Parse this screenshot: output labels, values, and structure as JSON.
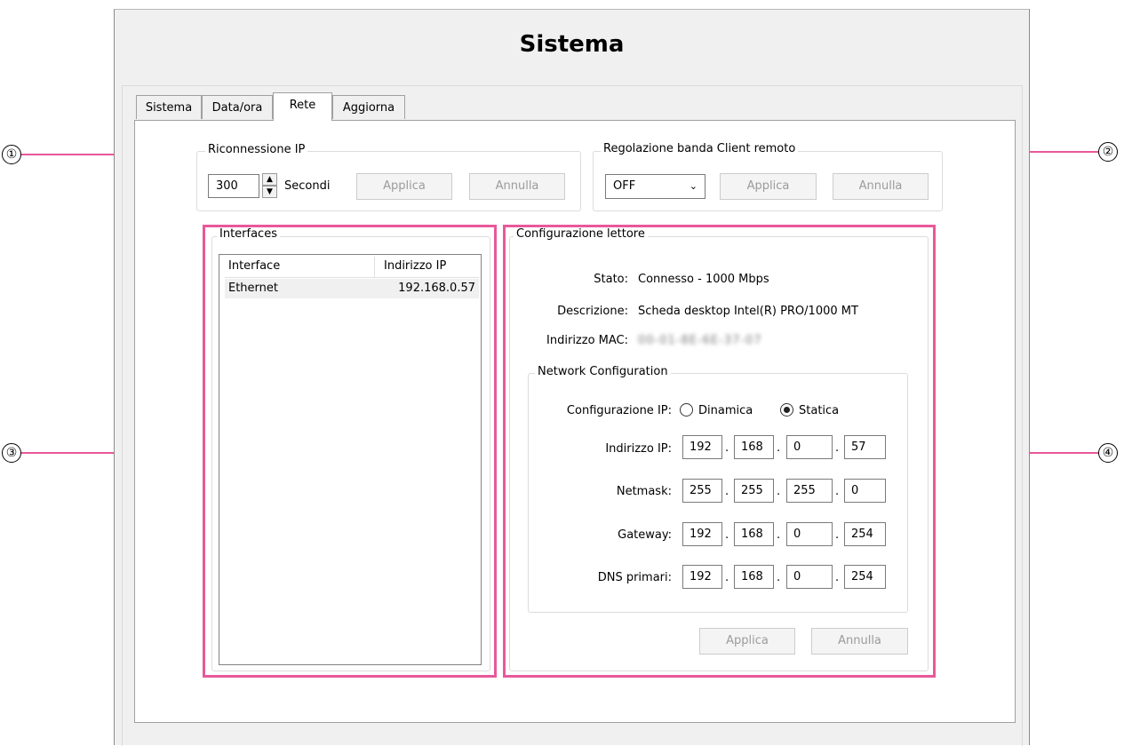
{
  "window": {
    "title": "Sistema"
  },
  "tabs": [
    {
      "label": "Sistema"
    },
    {
      "label": "Data/ora"
    },
    {
      "label": "Rete",
      "active": true
    },
    {
      "label": "Aggiorna"
    }
  ],
  "callouts": [
    "①",
    "②",
    "③",
    "④"
  ],
  "ip_reconnect": {
    "legend": "Riconnessione IP",
    "value": "300",
    "unit": "Secondi",
    "apply": "Applica",
    "cancel": "Annulla"
  },
  "bandwidth": {
    "legend": "Regolazione banda Client remoto",
    "selected": "OFF",
    "apply": "Applica",
    "cancel": "Annulla"
  },
  "interfaces": {
    "legend": "Interfaces",
    "columns": [
      "Interface",
      "Indirizzo IP"
    ],
    "rows": [
      {
        "name": "Ethernet",
        "ip": "192.168.0.57"
      }
    ]
  },
  "player_config": {
    "legend": "Configurazione lettore",
    "status_label": "Stato:",
    "status_value": "Connesso - 1000 Mbps",
    "description_label": "Descrizione:",
    "description_value": "Scheda desktop Intel(R) PRO/1000 MT",
    "mac_label": "Indirizzo MAC:",
    "mac_value": "00-01-8E-6E-37-07",
    "network": {
      "legend": "Network Configuration",
      "ip_config_label": "Configurazione IP:",
      "dynamic_label": "Dinamica",
      "static_label": "Statica",
      "selected_mode": "static",
      "ip_label": "Indirizzo IP:",
      "ip": [
        "192",
        "168",
        "0",
        "57"
      ],
      "netmask_label": "Netmask:",
      "netmask": [
        "255",
        "255",
        "255",
        "0"
      ],
      "gateway_label": "Gateway:",
      "gateway": [
        "192",
        "168",
        "0",
        "254"
      ],
      "dns_label": "DNS primari:",
      "dns": [
        "192",
        "168",
        "0",
        "254"
      ]
    },
    "apply": "Applica",
    "cancel": "Annulla"
  },
  "colors": {
    "highlight": "#e8589a",
    "window_bg": "#f0f0f0",
    "panel_bg": "#ffffff"
  }
}
